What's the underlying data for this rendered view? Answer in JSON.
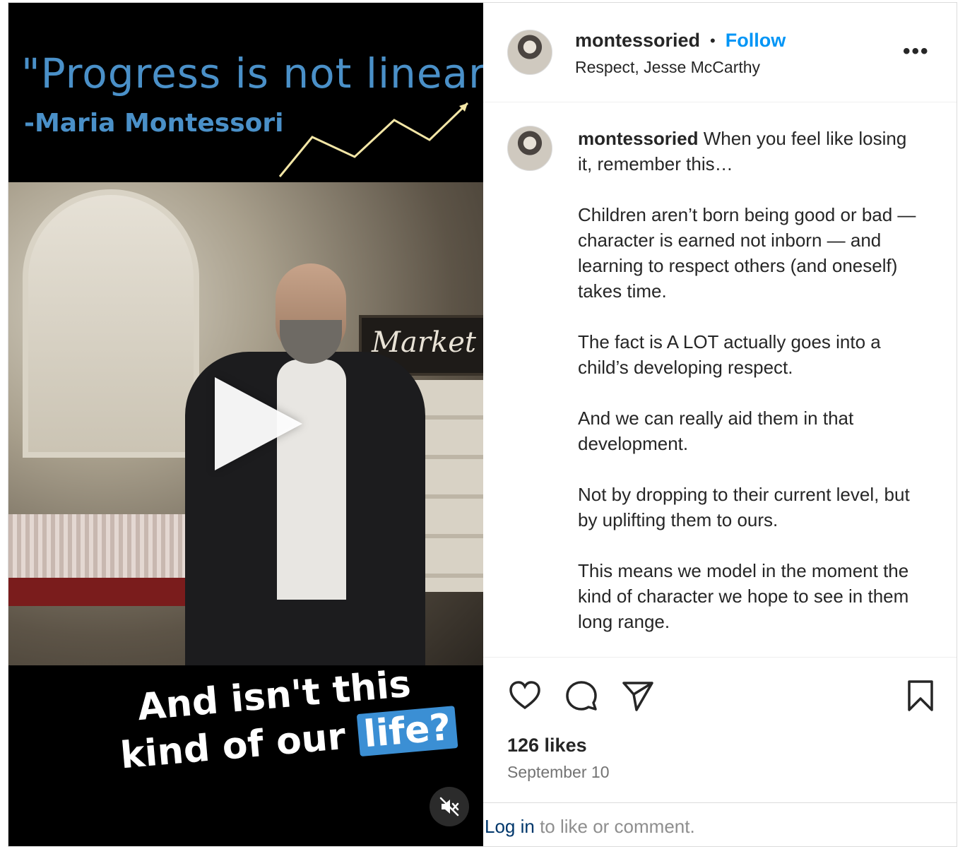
{
  "media": {
    "quote": "\"Progress is not linear.\"",
    "quote_author": "-Maria Montessori",
    "sign_text": "Market",
    "caption_line1": "And isn't this",
    "caption_line2_prefix": "kind of our",
    "caption_highlight": "life?",
    "play_icon": "play-icon",
    "mute_icon": "speaker-muted-icon"
  },
  "header": {
    "username": "montessoried",
    "separator": "•",
    "follow_label": "Follow",
    "location": "Respect, Jesse McCarthy",
    "more_label": "•••"
  },
  "caption": {
    "username": "montessoried",
    "paragraphs": [
      "When you feel like losing it, remember this…",
      "Children aren’t born being good or bad — character is earned not inborn — and learning to respect others (and oneself) takes time.",
      "The fact is A LOT actually goes into a child’s developing respect.",
      "And we can really aid them in that development.",
      "Not by dropping to their current level, but by uplifting them to ours.",
      "This means we model in the moment the kind of character we hope to see in them long range."
    ]
  },
  "actions": {
    "like_icon": "heart-icon",
    "comment_icon": "comment-icon",
    "share_icon": "send-icon",
    "save_icon": "bookmark-icon"
  },
  "stats": {
    "likes": "126 likes",
    "date": "September 10"
  },
  "login": {
    "link": "Log in",
    "rest": " to like or comment."
  },
  "colors": {
    "follow": "#0095f6",
    "quote": "#4a90c8",
    "highlight": "#3b8fd4"
  }
}
